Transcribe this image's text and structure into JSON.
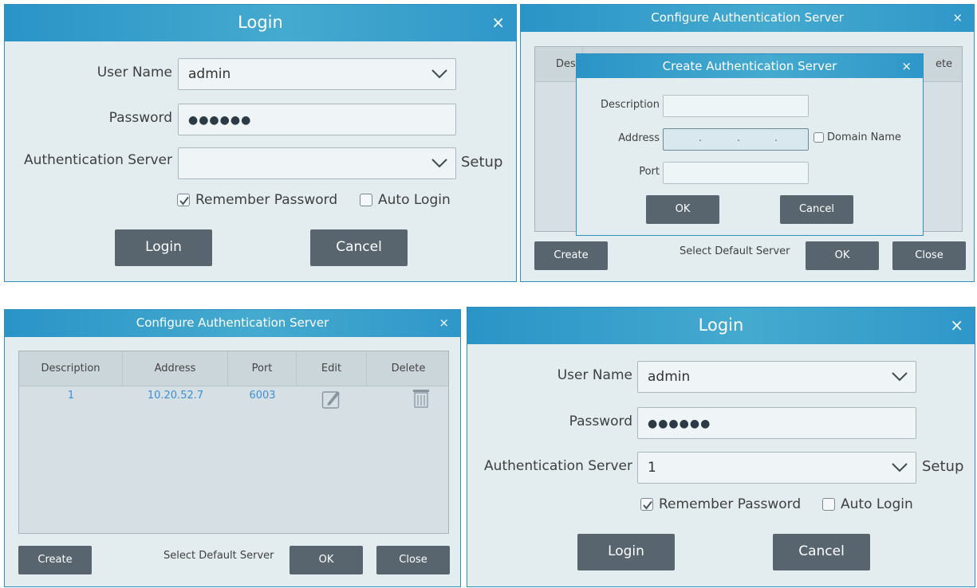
{
  "login1": {
    "title": "Login",
    "close": "×",
    "username_label": "User Name",
    "username_value": "admin",
    "password_label": "Password",
    "password_value": "●●●●●●",
    "auth_label": "Authentication Server",
    "auth_value": "",
    "setup": "Setup",
    "remember_label": "Remember Password",
    "remember_checked": true,
    "autologin_label": "Auto Login",
    "autologin_checked": false,
    "login_btn": "Login",
    "cancel_btn": "Cancel"
  },
  "config1": {
    "title": "Configure Authentication Server",
    "close": "×",
    "header_partial_left": "Des",
    "header_partial_right": "ete",
    "create_btn": "Create",
    "select_default": "Select Default Server",
    "ok_btn": "OK",
    "close_btn": "Close"
  },
  "create_dialog": {
    "title": "Create Authentication Server",
    "close": "×",
    "description_label": "Description",
    "address_label": "Address",
    "domain_label": "Domain Name",
    "domain_checked": false,
    "port_label": "Port",
    "ok_btn": "OK",
    "cancel_btn": "Cancel"
  },
  "config2": {
    "title": "Configure Authentication Server",
    "close": "×",
    "columns": [
      "Description",
      "Address",
      "Port",
      "Edit",
      "Delete"
    ],
    "rows": [
      {
        "description": "1",
        "address": "10.20.52.7",
        "port": "6003"
      }
    ],
    "create_btn": "Create",
    "select_default": "Select Default Server",
    "ok_btn": "OK",
    "close_btn": "Close"
  },
  "login2": {
    "title": "Login",
    "close": "×",
    "username_label": "User Name",
    "username_value": "admin",
    "password_label": "Password",
    "password_value": "●●●●●●",
    "auth_label": "Authentication Server",
    "auth_value": "1",
    "setup": "Setup",
    "remember_label": "Remember Password",
    "remember_checked": true,
    "autologin_label": "Auto Login",
    "autologin_checked": false,
    "login_btn": "Login",
    "cancel_btn": "Cancel"
  },
  "colors": {
    "titlebar": "#2a94c7",
    "panel_bg": "#e3edf0",
    "button_bg": "#58656e",
    "link_text": "#3c8ed3"
  }
}
